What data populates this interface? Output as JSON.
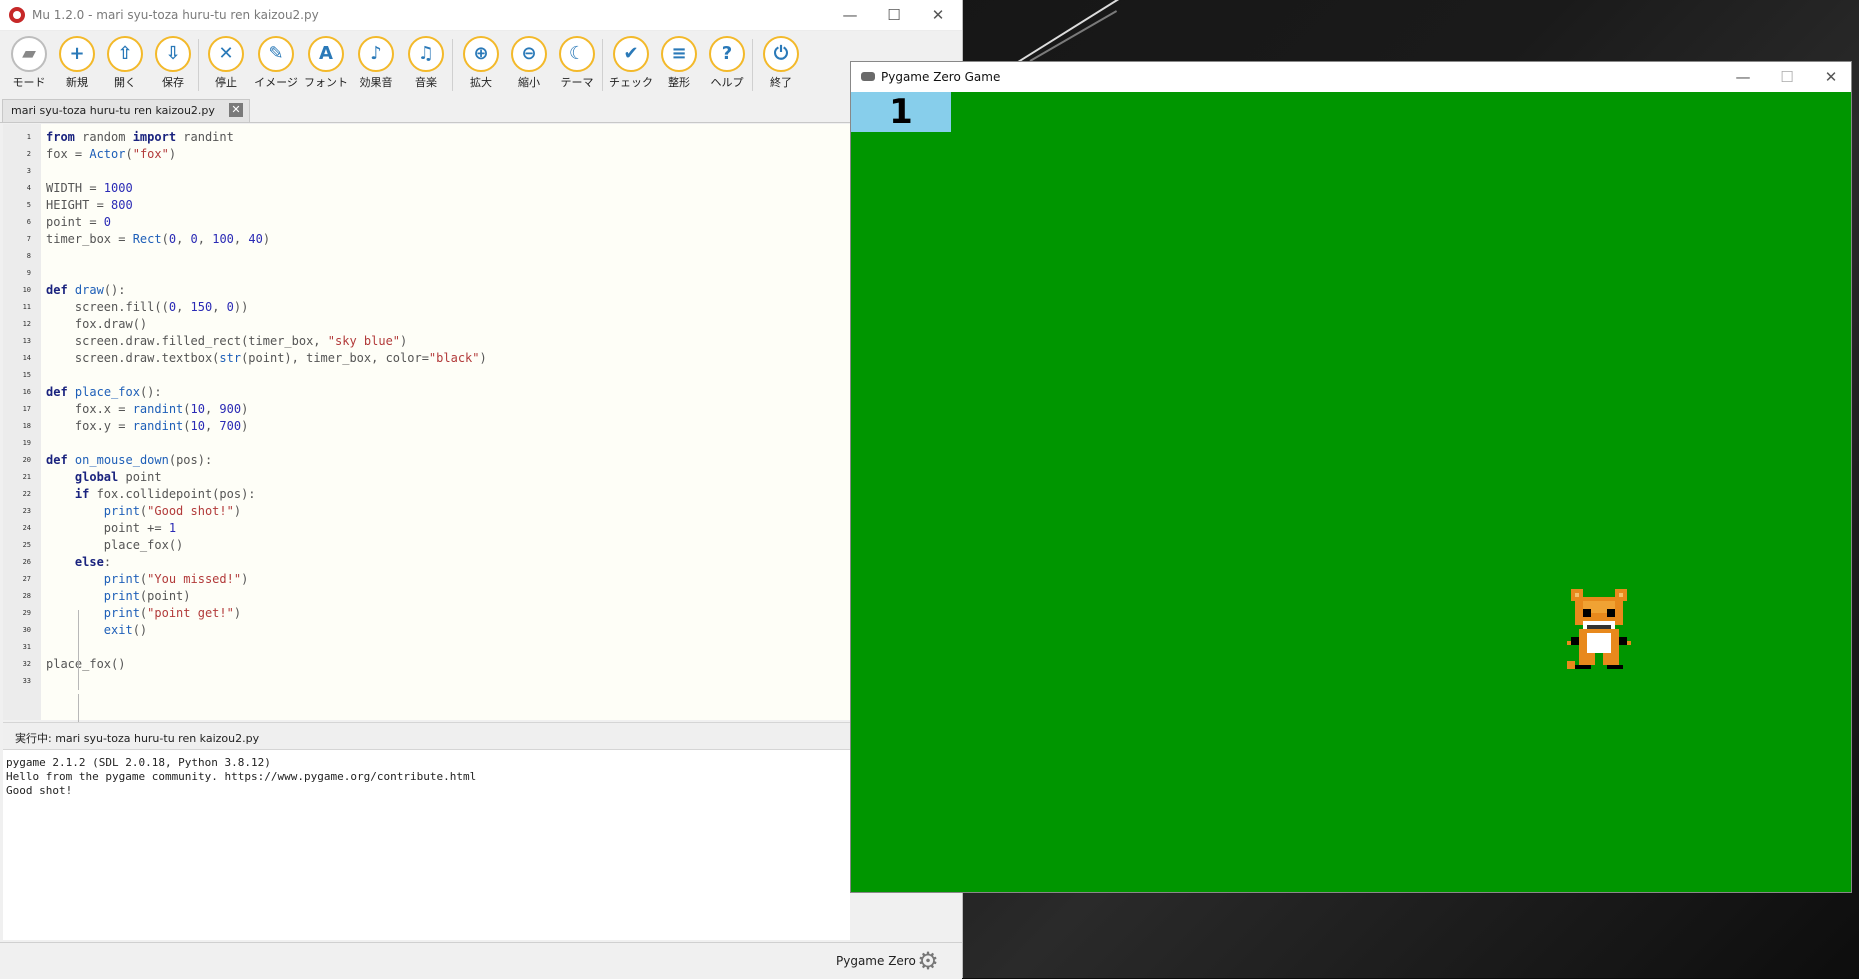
{
  "mu": {
    "title": "Mu 1.2.0 - mari syu-toza huru-tu ren kaizou2.py",
    "window_controls": {
      "minimize": "—",
      "maximize": "☐",
      "close": "✕"
    },
    "toolbar": [
      {
        "label": "モード",
        "icon": "mode-icon",
        "glyph": "▰"
      },
      {
        "label": "新規",
        "icon": "plus-icon",
        "glyph": "+"
      },
      {
        "label": "開く",
        "icon": "upload-icon",
        "glyph": "⇧"
      },
      {
        "label": "保存",
        "icon": "download-icon",
        "glyph": "⇩"
      },
      {
        "label": "停止",
        "icon": "stop-icon",
        "glyph": "✕"
      },
      {
        "label": "イメージ",
        "icon": "brush-icon",
        "glyph": "✎"
      },
      {
        "label": "フォント",
        "icon": "font-icon",
        "glyph": "A"
      },
      {
        "label": "効果音",
        "icon": "speaker-icon",
        "glyph": "♪"
      },
      {
        "label": "音楽",
        "icon": "music-icon",
        "glyph": "♫"
      },
      {
        "label": "拡大",
        "icon": "zoom-in-icon",
        "glyph": "⊕"
      },
      {
        "label": "縮小",
        "icon": "zoom-out-icon",
        "glyph": "⊖"
      },
      {
        "label": "テーマ",
        "icon": "moon-icon",
        "glyph": "☾"
      },
      {
        "label": "チェック",
        "icon": "thumbs-up-icon",
        "glyph": "✔"
      },
      {
        "label": "整形",
        "icon": "lines-icon",
        "glyph": "≡"
      },
      {
        "label": "ヘルプ",
        "icon": "help-icon",
        "glyph": "?"
      },
      {
        "label": "終了",
        "icon": "power-icon",
        "glyph": "⏻"
      }
    ],
    "tab": {
      "label": "mari syu-toza huru-tu ren kaizou2.py",
      "close_glyph": "✕"
    },
    "code_lines": [
      "from random import randint",
      "fox = Actor(\"fox\")",
      "",
      "WIDTH = 1000",
      "HEIGHT = 800",
      "point = 0",
      "timer_box = Rect(0, 0, 100, 40)",
      "",
      "",
      "def draw():",
      "    screen.fill((0, 150, 0))",
      "    fox.draw()",
      "    screen.draw.filled_rect(timer_box, \"sky blue\")",
      "    screen.draw.textbox(str(point), timer_box, color=\"black\")",
      "",
      "def place_fox():",
      "    fox.x = randint(10, 900)",
      "    fox.y = randint(10, 700)",
      "",
      "def on_mouse_down(pos):",
      "    global point",
      "    if fox.collidepoint(pos):",
      "        print(\"Good shot!\")",
      "        point += 1",
      "        place_fox()",
      "    else:",
      "        print(\"You missed!\")",
      "        print(point)",
      "        print(\"point get!\")",
      "        exit()",
      "",
      "place_fox()",
      ""
    ],
    "run_label": "実行中: mari syu-toza huru-tu ren kaizou2.py",
    "console_lines": [
      "pygame 2.1.2 (SDL 2.0.18, Python 3.8.12)",
      "Hello from the pygame community. https://www.pygame.org/contribute.html",
      "Good shot!"
    ],
    "mode": "Pygame Zero",
    "gear_glyph": "⚙"
  },
  "pygame": {
    "title": "Pygame Zero Game",
    "window_controls": {
      "minimize": "—",
      "maximize": "☐",
      "close": "✕"
    },
    "score": "1",
    "colors": {
      "background": "#009600",
      "score_box": "#87ceeb"
    }
  }
}
